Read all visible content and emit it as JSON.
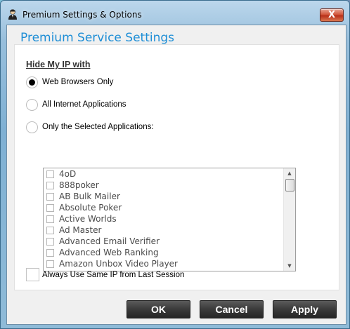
{
  "window": {
    "title": "Premium Settings & Options",
    "close_label": "X"
  },
  "header": {
    "title": "Premium Service Settings"
  },
  "hide_ip": {
    "section_label": "Hide My IP with",
    "options": [
      {
        "label": "Web Browsers Only",
        "selected": true
      },
      {
        "label": "All Internet Applications",
        "selected": false
      },
      {
        "label": "Only the Selected Applications:",
        "selected": false
      }
    ]
  },
  "applications": [
    {
      "name": "4oD",
      "checked": false
    },
    {
      "name": "888poker",
      "checked": false
    },
    {
      "name": "AB Bulk Mailer",
      "checked": false
    },
    {
      "name": "Absolute Poker",
      "checked": false
    },
    {
      "name": "Active Worlds",
      "checked": false
    },
    {
      "name": "Ad Master",
      "checked": false
    },
    {
      "name": "Advanced Email Verifier",
      "checked": false
    },
    {
      "name": "Advanced Web Ranking",
      "checked": false
    },
    {
      "name": "Amazon Unbox Video Player",
      "checked": false
    }
  ],
  "always_same_ip": {
    "label": "Always Use Same IP from Last Session",
    "checked": false
  },
  "buttons": {
    "ok": "OK",
    "cancel": "Cancel",
    "apply": "Apply"
  },
  "colors": {
    "header_accent": "#1e8ed6",
    "button_bg": "#333333",
    "close_button": "#c8432a"
  }
}
